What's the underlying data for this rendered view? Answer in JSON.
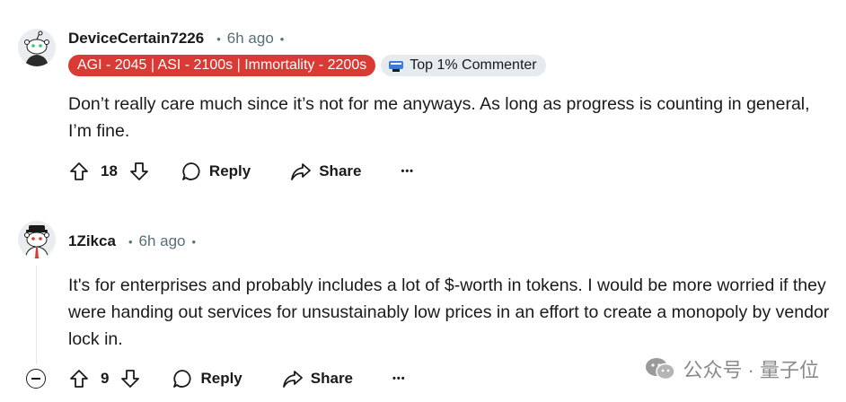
{
  "comments": [
    {
      "username": "DeviceCertain7226",
      "time": "6h ago",
      "flair": "AGI - 2045 | ASI - 2100s | Immortality - 2200s",
      "badge": "Top 1% Commenter",
      "body": "Don’t really care much since it’s not for me anyways. As long as progress is counting in general, I’m fine.",
      "score": "18",
      "reply_label": "Reply",
      "share_label": "Share",
      "more_label": "•••"
    },
    {
      "username": "1Zikca",
      "time": "6h ago",
      "body": "It's for enterprises and probably includes a lot of $-worth in tokens. I would be more worried if they were handing out services for unsustainably low prices in an effort to create a monopoly by vendor lock in.",
      "score": "9",
      "reply_label": "Reply",
      "share_label": "Share",
      "more_label": "•••"
    }
  ],
  "separator": "•",
  "watermark": "公众号 · 量子位",
  "colors": {
    "flair_red": "#d93a33",
    "badge_grey": "#e5ebee",
    "meta_grey": "#576f76"
  }
}
